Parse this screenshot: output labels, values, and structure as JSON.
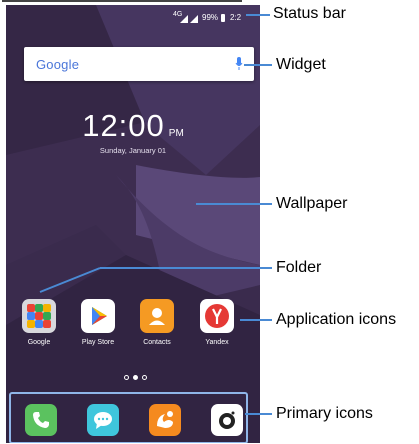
{
  "status_bar": {
    "network": "4G",
    "battery": "99%",
    "time": "2:2"
  },
  "search_widget": {
    "logo": "Google"
  },
  "clock": {
    "time": "12:00",
    "ampm": "PM",
    "date": "Sunday, January 01"
  },
  "apps": [
    {
      "label": "Google",
      "icon": "folder-icon"
    },
    {
      "label": "Play Store",
      "icon": "play-store-icon",
      "color": "#ffffff"
    },
    {
      "label": "Contacts",
      "icon": "contacts-icon",
      "color": "#f59a23"
    },
    {
      "label": "Yandex",
      "icon": "yandex-icon",
      "color": "#ffffff"
    }
  ],
  "page_indicator": {
    "pages": 3,
    "current": 2
  },
  "dock": [
    {
      "icon": "phone-icon",
      "color": "#5bc25f"
    },
    {
      "icon": "messages-icon",
      "color": "#3fc6dc"
    },
    {
      "icon": "uc-browser-icon",
      "color": "#f58a1f"
    },
    {
      "icon": "camera-icon",
      "color": "#ffffff"
    }
  ],
  "callouts": {
    "status_bar": "Status bar",
    "widget": "Widget",
    "wallpaper": "Wallpaper",
    "folder": "Folder",
    "application_icons": "Application icons",
    "primary_icons": "Primary icons"
  },
  "colors": {
    "accent_line": "#4a8ad4",
    "dock_border": "#8fb5e8",
    "wallpaper": "#403052"
  }
}
